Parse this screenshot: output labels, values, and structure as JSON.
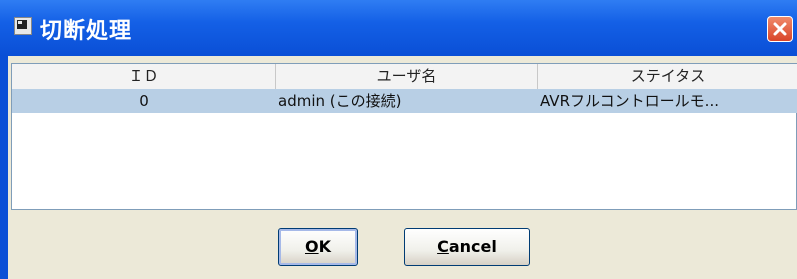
{
  "window": {
    "title": "切断処理",
    "icon": "app-window-icon",
    "close_icon": "close-icon",
    "colors": {
      "titlebar": "#0a4fd6",
      "selected_row": "#b8cfe5",
      "dialog_bg": "#ece9d8",
      "close_button": "#d9452a"
    }
  },
  "table": {
    "columns": [
      "ＩＤ",
      "ユーザ名",
      "ステイタス"
    ],
    "rows": [
      {
        "id": "0",
        "user": "admin (この接続)",
        "status": "AVRフルコントロールモ..."
      }
    ]
  },
  "buttons": {
    "ok": {
      "mnemonic": "O",
      "rest": "K"
    },
    "cancel": {
      "mnemonic": "C",
      "rest": "ancel"
    }
  }
}
